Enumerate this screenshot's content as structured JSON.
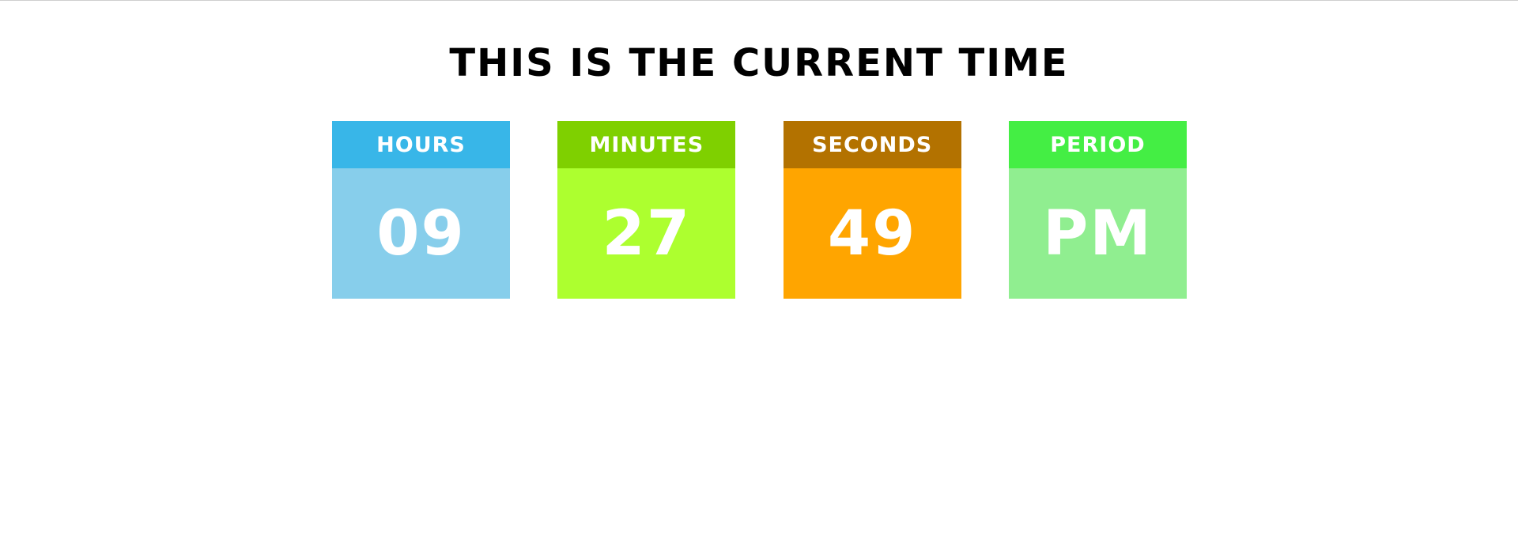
{
  "title": "THIS IS THE CURRENT TIME",
  "cards": [
    {
      "label": "HOURS",
      "value": "09",
      "header_color": "#38b6e8",
      "body_color": "#87ceeb"
    },
    {
      "label": "MINUTES",
      "value": "27",
      "header_color": "#7fd000",
      "body_color": "#adff2f"
    },
    {
      "label": "SECONDS",
      "value": "49",
      "header_color": "#b37200",
      "body_color": "#ffa500"
    },
    {
      "label": "PERIOD",
      "value": "PM",
      "header_color": "#44ee44",
      "body_color": "#90ee90"
    }
  ]
}
